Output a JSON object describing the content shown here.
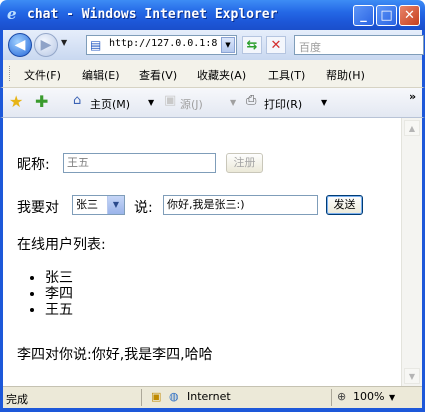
{
  "window": {
    "title": "chat - Windows Internet Explorer",
    "minimize": "_",
    "maximize": "□",
    "close": "✕"
  },
  "address": {
    "url": "http://127.0.0.1:8",
    "search_placeholder": "百度"
  },
  "menu": [
    "文件(F)",
    "编辑(E)",
    "查看(V)",
    "收藏夹(A)",
    "工具(T)",
    "帮助(H)"
  ],
  "command_bar": {
    "home": "主页(M)",
    "feeds": "源(J)",
    "print": "打印(R)"
  },
  "form": {
    "nickname_label": "昵称:",
    "nickname_value": "王五",
    "register_button": "注册",
    "to_label": "我要对",
    "target_user": "张三",
    "say_label": "说:",
    "message_value": "你好,我是张三:)",
    "send_button": "发送"
  },
  "users": {
    "heading": "在线用户列表:",
    "list": [
      "张三",
      "李四",
      "王五"
    ]
  },
  "messages": [
    "李四对你说:你好,我是李四,哈哈"
  ],
  "status": {
    "text": "完成",
    "zone": "Internet",
    "zoom": "100%"
  },
  "colors": {
    "titlebar": "#2468e6",
    "frame": "#1d58d9",
    "chrome": "#ece9d8"
  }
}
